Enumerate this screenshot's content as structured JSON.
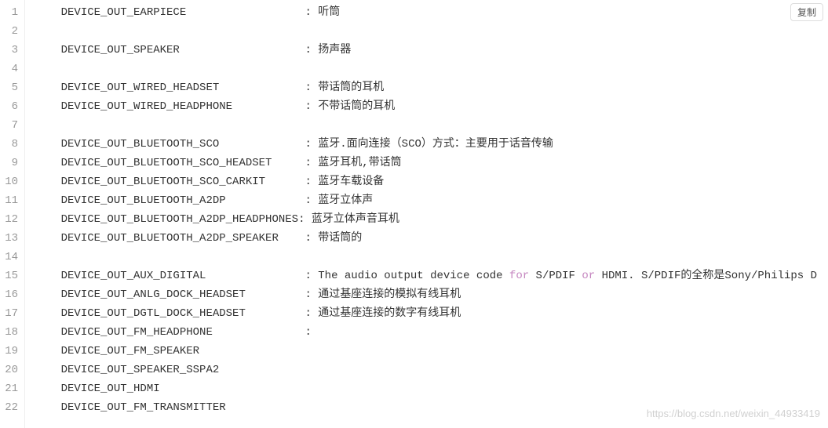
{
  "copy_button_label": "复制",
  "watermark": "https://blog.csdn.net/weixin_44933419",
  "keyword_for": "for",
  "keyword_or": "or",
  "lines": [
    {
      "n": "1",
      "segs": [
        {
          "t": "    "
        },
        {
          "t": "DEVICE_OUT_EARPIECE                  ",
          "cls": "tok-id"
        },
        {
          "t": ": ",
          "cls": "tok-pun"
        },
        {
          "t": "听筒",
          "cls": "tok-txt"
        }
      ]
    },
    {
      "n": "2",
      "segs": []
    },
    {
      "n": "3",
      "segs": [
        {
          "t": "    "
        },
        {
          "t": "DEVICE_OUT_SPEAKER                   ",
          "cls": "tok-id"
        },
        {
          "t": ": ",
          "cls": "tok-pun"
        },
        {
          "t": "扬声器",
          "cls": "tok-txt"
        }
      ]
    },
    {
      "n": "4",
      "segs": []
    },
    {
      "n": "5",
      "segs": [
        {
          "t": "    "
        },
        {
          "t": "DEVICE_OUT_WIRED_HEADSET             ",
          "cls": "tok-id"
        },
        {
          "t": ": ",
          "cls": "tok-pun"
        },
        {
          "t": "带话筒的耳机",
          "cls": "tok-txt"
        }
      ]
    },
    {
      "n": "6",
      "segs": [
        {
          "t": "    "
        },
        {
          "t": "DEVICE_OUT_WIRED_HEADPHONE           ",
          "cls": "tok-id"
        },
        {
          "t": ": ",
          "cls": "tok-pun"
        },
        {
          "t": "不带话筒的耳机",
          "cls": "tok-txt"
        }
      ]
    },
    {
      "n": "7",
      "segs": []
    },
    {
      "n": "8",
      "segs": [
        {
          "t": "    "
        },
        {
          "t": "DEVICE_OUT_BLUETOOTH_SCO             ",
          "cls": "tok-id"
        },
        {
          "t": ": ",
          "cls": "tok-pun"
        },
        {
          "t": "蓝牙.面向连接（SCO）方式：主要用于话音传输",
          "cls": "tok-txt"
        }
      ]
    },
    {
      "n": "9",
      "segs": [
        {
          "t": "    "
        },
        {
          "t": "DEVICE_OUT_BLUETOOTH_SCO_HEADSET     ",
          "cls": "tok-id"
        },
        {
          "t": ": ",
          "cls": "tok-pun"
        },
        {
          "t": "蓝牙耳机,带话筒",
          "cls": "tok-txt"
        }
      ]
    },
    {
      "n": "10",
      "segs": [
        {
          "t": "    "
        },
        {
          "t": "DEVICE_OUT_BLUETOOTH_SCO_CARKIT      ",
          "cls": "tok-id"
        },
        {
          "t": ": ",
          "cls": "tok-pun"
        },
        {
          "t": "蓝牙车载设备",
          "cls": "tok-txt"
        }
      ]
    },
    {
      "n": "11",
      "segs": [
        {
          "t": "    "
        },
        {
          "t": "DEVICE_OUT_BLUETOOTH_A2DP            ",
          "cls": "tok-id"
        },
        {
          "t": ": ",
          "cls": "tok-pun"
        },
        {
          "t": "蓝牙立体声",
          "cls": "tok-txt"
        }
      ]
    },
    {
      "n": "12",
      "segs": [
        {
          "t": "    "
        },
        {
          "t": "DEVICE_OUT_BLUETOOTH_A2DP_HEADPHONES",
          "cls": "tok-id"
        },
        {
          "t": ": ",
          "cls": "tok-pun"
        },
        {
          "t": "蓝牙立体声音耳机",
          "cls": "tok-txt"
        }
      ]
    },
    {
      "n": "13",
      "segs": [
        {
          "t": "    "
        },
        {
          "t": "DEVICE_OUT_BLUETOOTH_A2DP_SPEAKER    ",
          "cls": "tok-id"
        },
        {
          "t": ": ",
          "cls": "tok-pun"
        },
        {
          "t": "带话筒的",
          "cls": "tok-txt"
        }
      ]
    },
    {
      "n": "14",
      "segs": []
    },
    {
      "n": "15",
      "segs": [
        {
          "t": "    "
        },
        {
          "t": "DEVICE_OUT_AUX_DIGITAL               ",
          "cls": "tok-id"
        },
        {
          "t": ": ",
          "cls": "tok-pun"
        },
        {
          "t": "The audio output device code ",
          "cls": "tok-txt"
        },
        {
          "t": "for",
          "cls": "tok-kw"
        },
        {
          "t": " S/PDIF ",
          "cls": "tok-txt"
        },
        {
          "t": "or",
          "cls": "tok-kw"
        },
        {
          "t": " HDMI. S/PDIF的全称是Sony/Philips D",
          "cls": "tok-txt"
        }
      ]
    },
    {
      "n": "16",
      "segs": [
        {
          "t": "    "
        },
        {
          "t": "DEVICE_OUT_ANLG_DOCK_HEADSET         ",
          "cls": "tok-id"
        },
        {
          "t": ": ",
          "cls": "tok-pun"
        },
        {
          "t": "通过基座连接的模拟有线耳机",
          "cls": "tok-txt"
        }
      ]
    },
    {
      "n": "17",
      "segs": [
        {
          "t": "    "
        },
        {
          "t": "DEVICE_OUT_DGTL_DOCK_HEADSET         ",
          "cls": "tok-id"
        },
        {
          "t": ": ",
          "cls": "tok-pun"
        },
        {
          "t": "通过基座连接的数字有线耳机",
          "cls": "tok-txt"
        }
      ]
    },
    {
      "n": "18",
      "segs": [
        {
          "t": "    "
        },
        {
          "t": "DEVICE_OUT_FM_HEADPHONE              ",
          "cls": "tok-id"
        },
        {
          "t": ":",
          "cls": "tok-pun"
        }
      ]
    },
    {
      "n": "19",
      "segs": [
        {
          "t": "    "
        },
        {
          "t": "DEVICE_OUT_FM_SPEAKER",
          "cls": "tok-id"
        }
      ]
    },
    {
      "n": "20",
      "segs": [
        {
          "t": "    "
        },
        {
          "t": "DEVICE_OUT_SPEAKER_SSPA2",
          "cls": "tok-id"
        }
      ]
    },
    {
      "n": "21",
      "segs": [
        {
          "t": "    "
        },
        {
          "t": "DEVICE_OUT_HDMI",
          "cls": "tok-id"
        }
      ]
    },
    {
      "n": "22",
      "segs": [
        {
          "t": "    "
        },
        {
          "t": "DEVICE_OUT_FM_TRANSMITTER",
          "cls": "tok-id"
        }
      ]
    }
  ]
}
